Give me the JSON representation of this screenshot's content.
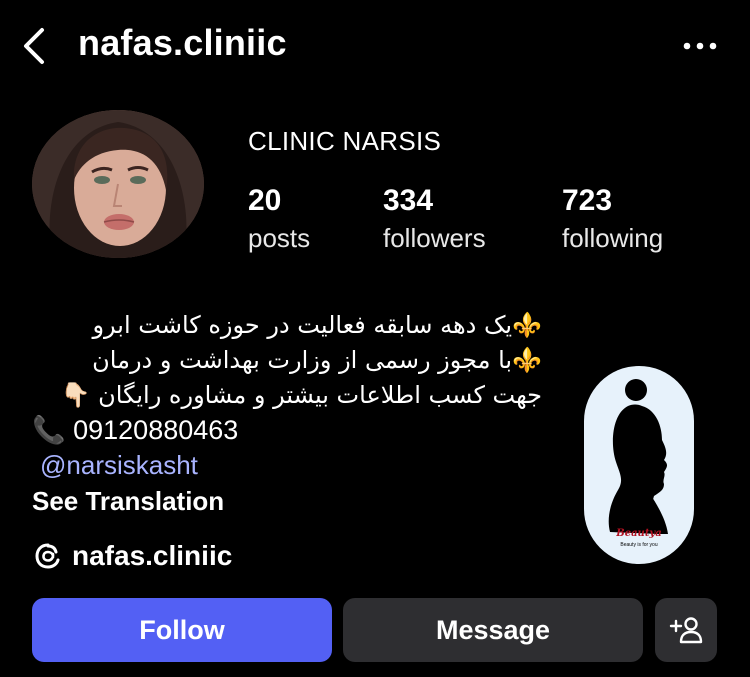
{
  "header": {
    "username": "nafas.cliniic",
    "back_icon": "chevron-left-icon",
    "more_icon": "more-horizontal-icon"
  },
  "profile": {
    "display_name": "CLINIC NARSIS",
    "stats": {
      "posts": {
        "value": "20",
        "label": "posts"
      },
      "followers": {
        "value": "334",
        "label": "followers"
      },
      "following": {
        "value": "723",
        "label": "following"
      }
    }
  },
  "bio": {
    "line1": "⚜️یک دهه سابقه فعالیت در حوزه کاشت ابرو",
    "line2": "⚜️با مجوز رسمی از وزارت بهداشت و درمان",
    "line3": "جهت کسب اطلاعات بیشتر و مشاوره رایگان 👇🏻",
    "phone": "📞 09120880463",
    "mention": "@narsiskasht",
    "see_translation": "See Translation"
  },
  "threads": {
    "handle": "nafas.cliniic",
    "icon": "threads-icon"
  },
  "highlight": {
    "brand": "Beautya",
    "tagline": "Beauty is for you"
  },
  "actions": {
    "follow": "Follow",
    "message": "Message",
    "add_user_icon": "add-person-icon"
  },
  "colors": {
    "background": "#000000",
    "follow_button": "#5360f4",
    "secondary_button": "#2e2e31",
    "mention": "#a9b4ff"
  }
}
